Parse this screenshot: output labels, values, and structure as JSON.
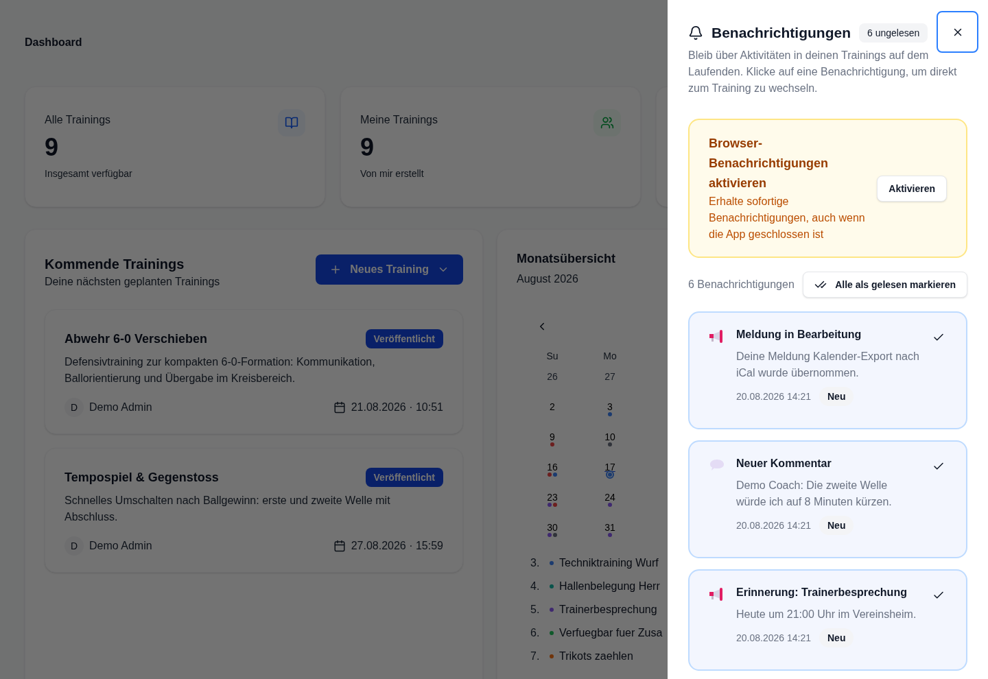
{
  "page": {
    "title": "Dashboard"
  },
  "stats": [
    {
      "label": "Alle Trainings",
      "value": "9",
      "caption": "Insgesamt verfügbar",
      "kind": "book"
    },
    {
      "label": "Meine Trainings",
      "value": "9",
      "caption": "Von mir erstellt",
      "kind": "users"
    }
  ],
  "upcoming": {
    "title": "Kommende Trainings",
    "subtitle": "Deine nächsten geplanten Trainings",
    "new_button": "Neues Training",
    "trainings": [
      {
        "title": "Abwehr 6-0 Verschieben",
        "status": "Veröffentlicht",
        "description": "Defensivtraining zur kompakten 6-0-Formation: Kommunikation, Ballorientierung und Übergabe im Kreisbereich.",
        "avatar": "D",
        "author": "Demo Admin",
        "date": "21.08.2026 · 10:51"
      },
      {
        "title": "Tempospiel & Gegenstoss",
        "status": "Veröffentlicht",
        "description": "Schnelles Umschalten nach Ballgewinn: erste und zweite Welle mit Abschluss.",
        "avatar": "D",
        "author": "Demo Admin",
        "date": "27.08.2026 · 15:59"
      }
    ]
  },
  "calendar": {
    "title": "Monatsübersicht",
    "month": "August 2026",
    "weekdays": [
      "Su",
      "Mo"
    ],
    "days": [
      {
        "day": "26",
        "outside": true,
        "selected": false
      },
      {
        "day": "27",
        "outside": true,
        "selected": false
      },
      {
        "day": "2",
        "outside": false,
        "selected": false
      },
      {
        "day": "3",
        "outside": false,
        "selected": false,
        "dots": [
          {
            "color": "#1b3b6f"
          }
        ]
      },
      {
        "day": "9",
        "outside": false,
        "selected": false,
        "dots": [
          {
            "color": "#6c1f1f"
          }
        ]
      },
      {
        "day": "10",
        "outside": false,
        "selected": false,
        "dots": [
          {
            "color": "#30333a"
          }
        ]
      },
      {
        "day": "16",
        "outside": false,
        "selected": false,
        "dots": [
          {
            "color": "#6c1f1f"
          },
          {
            "color": "#1b3b6f"
          }
        ]
      },
      {
        "day": "17",
        "outside": false,
        "selected": true,
        "dots": [
          {
            "color": "#1b3b6f"
          }
        ]
      },
      {
        "day": "23",
        "outside": false,
        "selected": false,
        "dots": [
          {
            "color": "#3f296f"
          },
          {
            "color": "#6c1f1f"
          }
        ]
      },
      {
        "day": "24",
        "outside": false,
        "selected": false,
        "dots": [
          {
            "color": "#3f296f"
          }
        ]
      },
      {
        "day": "30",
        "outside": false,
        "selected": false,
        "dots": [
          {
            "color": "#3f296f"
          },
          {
            "color": "#30333a"
          }
        ]
      },
      {
        "day": "31",
        "outside": false,
        "selected": false,
        "dots": [
          {
            "color": "#3f296f"
          }
        ]
      }
    ],
    "events": [
      {
        "number": "3.",
        "title": "Techniktraining Wurf",
        "color": "#1b3b6f"
      },
      {
        "number": "4.",
        "title": "Hallenbelegung Herr",
        "color": "#09534b"
      },
      {
        "number": "5.",
        "title": "Trainerbesprechung",
        "color": "#3f296f"
      },
      {
        "number": "6.",
        "title": "Verfuegbar fuer Zusa",
        "color": "#0f592a"
      },
      {
        "number": "7.",
        "title": "Trikots zaehlen",
        "color": "#70340a"
      }
    ]
  },
  "drawer": {
    "title": "Benachrichtigungen",
    "unread_badge": "6 ungelesen",
    "description": "Bleib über Aktivitäten in deinen Trainings auf dem Laufenden. Klicke auf eine Benachrichtigung, um direkt zum Training zu wechseln.",
    "browser_prompt": {
      "title": "Browser-Benachrichtigungen aktivieren",
      "text": "Erhalte sofortige Benachrichtigungen, auch wenn die App geschlossen ist",
      "button": "Aktivieren"
    },
    "count": "6 Benachrichtigungen",
    "mark_all": "Alle als gelesen markieren",
    "notifications": [
      {
        "kind": "megaphone",
        "title": "Meldung in Bearbeitung",
        "text": "Deine Meldung Kalender-Export nach iCal wurde übernommen.",
        "time": "20.08.2026 14:21",
        "badge": "Neu",
        "unread": true
      },
      {
        "kind": "comment",
        "title": "Neuer Kommentar",
        "text": "Demo Coach: Die zweite Welle würde ich auf 8 Minuten kürzen.",
        "time": "20.08.2026 14:21",
        "badge": "Neu",
        "unread": true
      },
      {
        "kind": "megaphone",
        "title": "Erinnerung: Trainerbesprechung",
        "text": "Heute um 21:00 Uhr im Vereinsheim.",
        "time": "20.08.2026 14:21",
        "badge": "Neu",
        "unread": true
      }
    ]
  }
}
